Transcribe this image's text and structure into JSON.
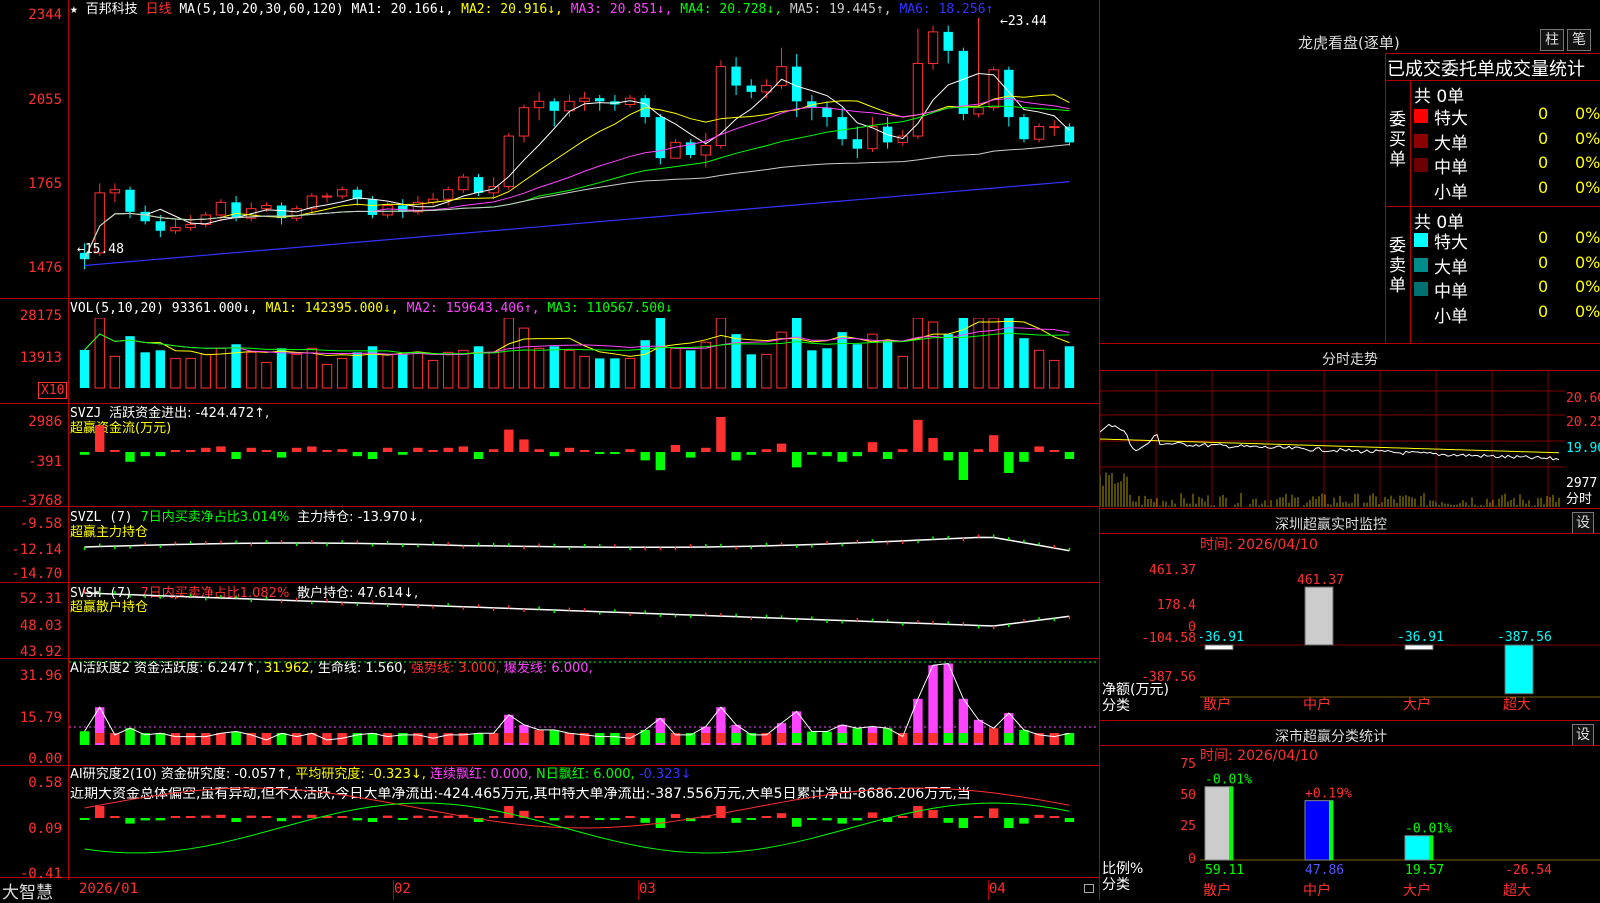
{
  "header": {
    "star": "★",
    "stock_name": "百邦科技",
    "period": "日线",
    "ma_label": "MA(5,10,20,30,60,120)",
    "ma1": "MA1: 20.166↓,",
    "ma2": "MA2: 20.916↓,",
    "ma3": "MA3: 20.851↓,",
    "ma4": "MA4: 20.728↓,",
    "ma5": "MA5: 19.445↑,",
    "ma6": "MA6: 18.256↑"
  },
  "colors": {
    "up": "#ff3030",
    "down": "#00ffff",
    "ma1": "#ffffff",
    "ma2": "#ffff00",
    "ma3": "#ff44ff",
    "ma4": "#00ff00",
    "ma5": "#cccccc",
    "ma6": "#3333ff",
    "green": "#00ff00"
  },
  "price_axis": [
    "2344",
    "2055",
    "1765",
    "1476"
  ],
  "annotations": {
    "high": "23.44",
    "low": "15.48"
  },
  "vol_panel": {
    "label": "VOL(5,10,20)",
    "value": "93361.000↓,",
    "ma1": "MA1: 142395.000↓,",
    "ma2": "MA2: 159643.406↑,",
    "ma3": "MA3: 110567.500↓",
    "axis": [
      "28175",
      "13913"
    ],
    "unit": "X10"
  },
  "svzj_panel": {
    "label": "SVZJ",
    "text": "活跃资金进出: -424.472↑,",
    "subtitle": "超赢资金流(万元)",
    "axis": [
      "2986",
      "-391",
      "-3768"
    ]
  },
  "svzl_panel": {
    "label": "SVZL (7)",
    "red_text": "7日内买卖净占比3.014%",
    "text": "主力持仓: -13.970↓,",
    "subtitle": "超赢主力持仓",
    "axis": [
      "-9.58",
      "-12.14",
      "-14.70"
    ]
  },
  "svsh_panel": {
    "label": "SVSH (7)",
    "red_text": "7日内买卖净占比1.082%",
    "text": "散户持仓: 47.614↓,",
    "subtitle": "超赢散户持仓",
    "axis": [
      "52.31",
      "48.03",
      "43.92"
    ]
  },
  "ai_active_panel": {
    "label": "AI活跃度2",
    "text1": "资金活跃度: 6.247↑,",
    "text2": "31.962,",
    "text3": "生命线: 1.560,",
    "text4": "强势线: 3.000,",
    "text5": "爆发线: 6.000,",
    "axis": [
      "31.96",
      "15.79",
      "0.00"
    ]
  },
  "ai_research_panel": {
    "label": "AI研究度2(10)",
    "text1": "资金研究度: -0.057↑,",
    "text2": "平均研究度: -0.323↓,",
    "text3": "连续飘红: 0.000,",
    "text4": "N日飘红: 6.000,",
    "text5": "-0.323↓",
    "comment": "近期大资金总体偏空,虽有异动,但不太活跃,今日大单净流出:-424.465万元,其中特大单净流出:-387.556万元,大单5日累计净出-8686.206万元,当",
    "axis": [
      "0.58",
      "0.09",
      "-0.41"
    ]
  },
  "date_axis": {
    "brand": "大智慧",
    "dates": [
      "2026/01",
      "02",
      "03",
      "04"
    ]
  },
  "right_panel": {
    "longhu": {
      "title": "龙虎看盘(逐单)",
      "btn1": "柱",
      "btn2": "笔",
      "subtitle": "已成交委托单成交量统计"
    },
    "buy": {
      "side_label": "委买单",
      "total": "共 0单",
      "rows": [
        {
          "name": "特大",
          "count": "0",
          "pct": "0%"
        },
        {
          "name": "大单",
          "count": "0",
          "pct": "0%"
        },
        {
          "name": "中单",
          "count": "0",
          "pct": "0%"
        },
        {
          "name": "小单",
          "count": "0",
          "pct": "0%"
        }
      ]
    },
    "sell": {
      "side_label": "委卖单",
      "total": "共 0单",
      "rows": [
        {
          "name": "特大",
          "count": "0",
          "pct": "0%"
        },
        {
          "name": "大单",
          "count": "0",
          "pct": "0%"
        },
        {
          "name": "中单",
          "count": "0",
          "pct": "0%"
        },
        {
          "name": "小单",
          "count": "0",
          "pct": "0%"
        }
      ]
    },
    "intraday": {
      "title": "分时走势",
      "axis": [
        "20.60",
        "20.25",
        "19.90"
      ],
      "vol": "2977",
      "vol_unit": "分时"
    },
    "sz_monitor": {
      "title": "深圳超赢实时监控",
      "btn": "设",
      "time": "时间: 2026/04/10",
      "axis": [
        "461.37",
        "178.4",
        "0",
        "-104.58",
        "-387.56"
      ],
      "ylabel": "净额(万元)",
      "xlabel": "分类",
      "categories": [
        "散户",
        "中户",
        "大户",
        "超大"
      ],
      "values": [
        "-36.91",
        "461.37",
        "-36.91",
        "-387.56"
      ]
    },
    "sz_class": {
      "title": "深市超赢分类统计",
      "btn": "设",
      "time": "时间: 2026/04/10",
      "axis": [
        "75",
        "50",
        "25",
        "0"
      ],
      "ylabel": "比例%",
      "xlabel": "分类",
      "categories": [
        "散户",
        "中户",
        "大户",
        "超大"
      ],
      "top_labels": [
        "-0.01%",
        "+0.19%",
        "-0.01%"
      ],
      "bottom_labels": [
        "59.11",
        "47.86",
        "19.57",
        "-26.54"
      ]
    }
  },
  "chart_data": {
    "type": "candlestick",
    "ylim": [
      14.76,
      23.44
    ],
    "y_ticks": [
      "2344",
      "2055",
      "1765",
      "1476"
    ],
    "x_ticks": [
      "2026/01",
      "02",
      "03",
      "04"
    ],
    "ohlc": [
      [
        16.0,
        15.8,
        16.3,
        15.48
      ],
      [
        16.0,
        17.9,
        18.2,
        15.9
      ],
      [
        17.9,
        18.0,
        18.2,
        17.6
      ],
      [
        18.0,
        17.3,
        18.1,
        17.1
      ],
      [
        17.3,
        17.0,
        17.5,
        16.9
      ],
      [
        17.0,
        16.7,
        17.2,
        16.5
      ],
      [
        16.7,
        16.8,
        17.1,
        16.6
      ],
      [
        16.8,
        16.9,
        17.2,
        16.7
      ],
      [
        16.9,
        17.2,
        17.3,
        16.8
      ],
      [
        17.2,
        17.6,
        17.7,
        17.0
      ],
      [
        17.6,
        17.1,
        17.8,
        17.0
      ],
      [
        17.1,
        17.4,
        17.6,
        17.0
      ],
      [
        17.4,
        17.5,
        17.6,
        17.3
      ],
      [
        17.5,
        17.1,
        17.6,
        16.9
      ],
      [
        17.1,
        17.4,
        17.5,
        17.0
      ],
      [
        17.4,
        17.8,
        17.9,
        17.2
      ],
      [
        17.8,
        17.8,
        17.9,
        17.6
      ],
      [
        17.8,
        18.0,
        18.1,
        17.7
      ],
      [
        18.0,
        17.7,
        18.1,
        17.5
      ],
      [
        17.7,
        17.2,
        17.8,
        17.1
      ],
      [
        17.2,
        17.5,
        17.6,
        17.1
      ],
      [
        17.5,
        17.3,
        17.7,
        17.1
      ],
      [
        17.3,
        17.6,
        17.8,
        17.2
      ],
      [
        17.6,
        17.7,
        17.9,
        17.5
      ],
      [
        17.7,
        18.0,
        18.1,
        17.5
      ],
      [
        18.0,
        18.4,
        18.5,
        17.9
      ],
      [
        18.4,
        17.9,
        18.5,
        17.8
      ],
      [
        17.9,
        18.1,
        18.4,
        17.7
      ],
      [
        18.1,
        19.7,
        19.8,
        18.0
      ],
      [
        19.7,
        20.6,
        20.7,
        19.5
      ],
      [
        20.6,
        20.8,
        21.1,
        20.2
      ],
      [
        20.8,
        20.5,
        20.9,
        20.0
      ],
      [
        20.5,
        20.8,
        21.0,
        20.3
      ],
      [
        20.8,
        20.9,
        21.1,
        20.5
      ],
      [
        20.9,
        20.8,
        21.0,
        20.5
      ],
      [
        20.8,
        20.7,
        21.0,
        20.5
      ],
      [
        20.7,
        20.9,
        21.0,
        20.6
      ],
      [
        20.9,
        20.3,
        21.0,
        20.1
      ],
      [
        20.3,
        19.0,
        20.4,
        18.8
      ],
      [
        19.0,
        19.5,
        19.6,
        19.0
      ],
      [
        19.5,
        19.1,
        19.6,
        19.0
      ],
      [
        19.1,
        19.4,
        19.8,
        18.7
      ],
      [
        19.4,
        21.9,
        22.1,
        19.3
      ],
      [
        21.9,
        21.3,
        22.2,
        21.0
      ],
      [
        21.3,
        21.1,
        21.5,
        20.9
      ],
      [
        21.1,
        21.3,
        21.5,
        20.9
      ],
      [
        21.3,
        21.9,
        22.5,
        21.2
      ],
      [
        21.9,
        20.8,
        22.3,
        20.3
      ],
      [
        20.8,
        20.6,
        21.0,
        20.2
      ],
      [
        20.6,
        20.3,
        20.8,
        20.0
      ],
      [
        20.3,
        19.6,
        20.6,
        19.4
      ],
      [
        19.6,
        19.3,
        20.0,
        19.0
      ],
      [
        19.3,
        20.0,
        20.3,
        19.2
      ],
      [
        20.0,
        19.5,
        20.3,
        19.3
      ],
      [
        19.5,
        19.7,
        19.9,
        19.4
      ],
      [
        19.7,
        22.0,
        23.1,
        19.6
      ],
      [
        22.0,
        23.0,
        23.2,
        21.8
      ],
      [
        23.0,
        22.4,
        23.2,
        22.0
      ],
      [
        22.4,
        20.4,
        22.5,
        20.2
      ],
      [
        20.4,
        20.6,
        23.44,
        20.3
      ],
      [
        20.6,
        21.8,
        21.9,
        20.5
      ],
      [
        21.8,
        20.3,
        21.9,
        20.0
      ],
      [
        20.3,
        19.6,
        20.4,
        19.5
      ],
      [
        19.6,
        20.0,
        20.1,
        19.5
      ],
      [
        20.0,
        20.0,
        20.2,
        19.7
      ],
      [
        20.0,
        19.5,
        20.1,
        19.4
      ]
    ]
  }
}
